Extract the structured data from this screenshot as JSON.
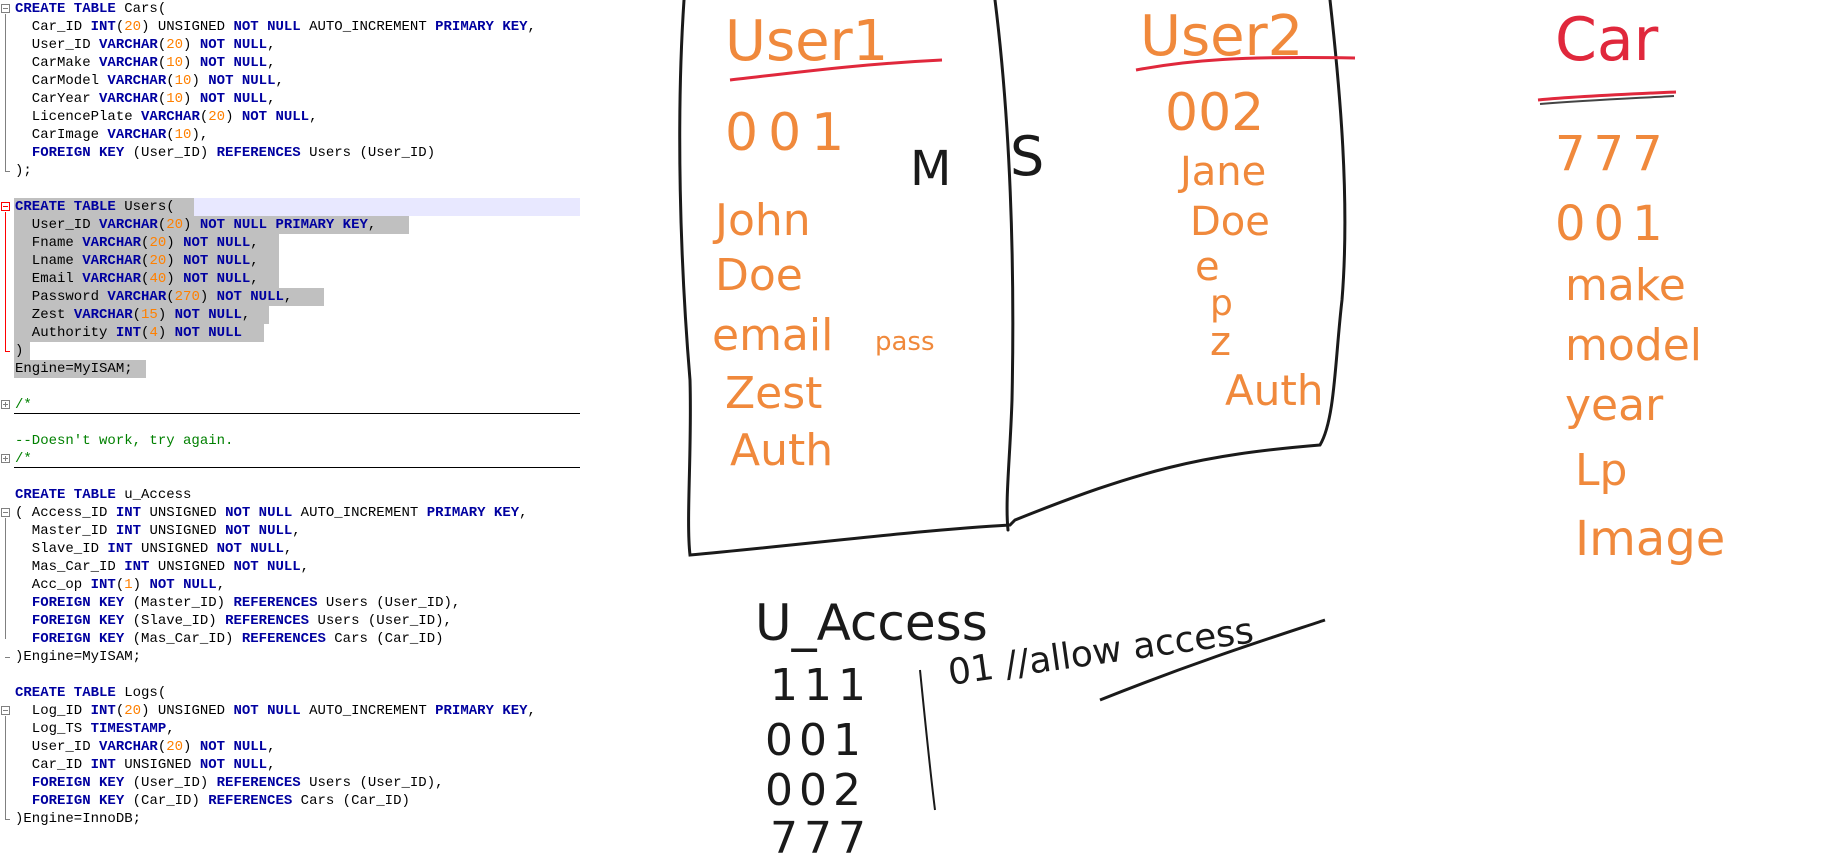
{
  "colors": {
    "keyword": "#0000a0",
    "number": "#ff8000",
    "comment": "#008000",
    "selection": "#c0c0c0",
    "current_line": "#e8e8ff",
    "sketch_orange": "#f0893c",
    "sketch_red": "#e0283c",
    "sketch_black": "#1a1a1a"
  },
  "code_lines": [
    [
      {
        "t": "CREATE TABLE",
        "k": "kw"
      },
      {
        "t": " Cars("
      }
    ],
    [
      {
        "t": "  Car_ID "
      },
      {
        "t": "INT",
        "k": "kw"
      },
      {
        "t": "("
      },
      {
        "t": "20",
        "k": "num"
      },
      {
        "t": ") UNSIGNED "
      },
      {
        "t": "NOT NULL",
        "k": "kw"
      },
      {
        "t": " AUTO_INCREMENT "
      },
      {
        "t": "PRIMARY KEY",
        "k": "kw"
      },
      {
        "t": ","
      }
    ],
    [
      {
        "t": "  User_ID "
      },
      {
        "t": "VARCHAR",
        "k": "kw"
      },
      {
        "t": "("
      },
      {
        "t": "20",
        "k": "num"
      },
      {
        "t": ") "
      },
      {
        "t": "NOT NULL",
        "k": "kw"
      },
      {
        "t": ","
      }
    ],
    [
      {
        "t": "  CarMake "
      },
      {
        "t": "VARCHAR",
        "k": "kw"
      },
      {
        "t": "("
      },
      {
        "t": "10",
        "k": "num"
      },
      {
        "t": ") "
      },
      {
        "t": "NOT NULL",
        "k": "kw"
      },
      {
        "t": ","
      }
    ],
    [
      {
        "t": "  CarModel "
      },
      {
        "t": "VARCHAR",
        "k": "kw"
      },
      {
        "t": "("
      },
      {
        "t": "10",
        "k": "num"
      },
      {
        "t": ") "
      },
      {
        "t": "NOT NULL",
        "k": "kw"
      },
      {
        "t": ","
      }
    ],
    [
      {
        "t": "  CarYear "
      },
      {
        "t": "VARCHAR",
        "k": "kw"
      },
      {
        "t": "("
      },
      {
        "t": "10",
        "k": "num"
      },
      {
        "t": ") "
      },
      {
        "t": "NOT NULL",
        "k": "kw"
      },
      {
        "t": ","
      }
    ],
    [
      {
        "t": "  LicencePlate "
      },
      {
        "t": "VARCHAR",
        "k": "kw"
      },
      {
        "t": "("
      },
      {
        "t": "20",
        "k": "num"
      },
      {
        "t": ") "
      },
      {
        "t": "NOT NULL",
        "k": "kw"
      },
      {
        "t": ","
      }
    ],
    [
      {
        "t": "  CarImage "
      },
      {
        "t": "VARCHAR",
        "k": "kw"
      },
      {
        "t": "("
      },
      {
        "t": "10",
        "k": "num"
      },
      {
        "t": "),"
      }
    ],
    [
      {
        "t": "  "
      },
      {
        "t": "FOREIGN KEY",
        "k": "kw"
      },
      {
        "t": " (User_ID) "
      },
      {
        "t": "REFERENCES",
        "k": "kw"
      },
      {
        "t": " Users (User_ID)"
      }
    ],
    [
      {
        "t": ");"
      }
    ],
    [],
    [
      {
        "t": "CREATE TABLE",
        "k": "kw"
      },
      {
        "t": " Users("
      }
    ],
    [
      {
        "t": "  User_ID "
      },
      {
        "t": "VARCHAR",
        "k": "kw"
      },
      {
        "t": "("
      },
      {
        "t": "20",
        "k": "num"
      },
      {
        "t": ") "
      },
      {
        "t": "NOT NULL PRIMARY KEY",
        "k": "kw"
      },
      {
        "t": ","
      }
    ],
    [
      {
        "t": "  Fname "
      },
      {
        "t": "VARCHAR",
        "k": "kw"
      },
      {
        "t": "("
      },
      {
        "t": "20",
        "k": "num"
      },
      {
        "t": ") "
      },
      {
        "t": "NOT NULL",
        "k": "kw"
      },
      {
        "t": ","
      }
    ],
    [
      {
        "t": "  Lname "
      },
      {
        "t": "VARCHAR",
        "k": "kw"
      },
      {
        "t": "("
      },
      {
        "t": "20",
        "k": "num"
      },
      {
        "t": ") "
      },
      {
        "t": "NOT NULL",
        "k": "kw"
      },
      {
        "t": ","
      }
    ],
    [
      {
        "t": "  Email "
      },
      {
        "t": "VARCHAR",
        "k": "kw"
      },
      {
        "t": "("
      },
      {
        "t": "40",
        "k": "num"
      },
      {
        "t": ") "
      },
      {
        "t": "NOT NULL",
        "k": "kw"
      },
      {
        "t": ","
      }
    ],
    [
      {
        "t": "  Password "
      },
      {
        "t": "VARCHAR",
        "k": "kw"
      },
      {
        "t": "("
      },
      {
        "t": "270",
        "k": "num"
      },
      {
        "t": ") "
      },
      {
        "t": "NOT NULL",
        "k": "kw"
      },
      {
        "t": ","
      }
    ],
    [
      {
        "t": "  Zest "
      },
      {
        "t": "VARCHAR",
        "k": "kw"
      },
      {
        "t": "("
      },
      {
        "t": "15",
        "k": "num"
      },
      {
        "t": ") "
      },
      {
        "t": "NOT NULL",
        "k": "kw"
      },
      {
        "t": ","
      }
    ],
    [
      {
        "t": "  Authority "
      },
      {
        "t": "INT",
        "k": "kw"
      },
      {
        "t": "("
      },
      {
        "t": "4",
        "k": "num"
      },
      {
        "t": ") "
      },
      {
        "t": "NOT NULL",
        "k": "kw"
      }
    ],
    [
      {
        "t": ")"
      }
    ],
    [
      {
        "t": "Engine=MyISAM;"
      }
    ],
    [],
    [
      {
        "t": "/*",
        "k": "cmt"
      }
    ],
    [],
    [
      {
        "t": "--Doesn't work, try again.",
        "k": "cmt"
      }
    ],
    [
      {
        "t": "/*",
        "k": "cmt"
      }
    ],
    [],
    [
      {
        "t": "CREATE TABLE",
        "k": "kw"
      },
      {
        "t": " u_Access"
      }
    ],
    [
      {
        "t": "( Access_ID "
      },
      {
        "t": "INT",
        "k": "kw"
      },
      {
        "t": " UNSIGNED "
      },
      {
        "t": "NOT NULL",
        "k": "kw"
      },
      {
        "t": " AUTO_INCREMENT "
      },
      {
        "t": "PRIMARY KEY",
        "k": "kw"
      },
      {
        "t": ","
      }
    ],
    [
      {
        "t": "  Master_ID "
      },
      {
        "t": "INT",
        "k": "kw"
      },
      {
        "t": " UNSIGNED "
      },
      {
        "t": "NOT NULL",
        "k": "kw"
      },
      {
        "t": ","
      }
    ],
    [
      {
        "t": "  Slave_ID "
      },
      {
        "t": "INT",
        "k": "kw"
      },
      {
        "t": " UNSIGNED "
      },
      {
        "t": "NOT NULL",
        "k": "kw"
      },
      {
        "t": ","
      }
    ],
    [
      {
        "t": "  Mas_Car_ID "
      },
      {
        "t": "INT",
        "k": "kw"
      },
      {
        "t": " UNSIGNED "
      },
      {
        "t": "NOT NULL",
        "k": "kw"
      },
      {
        "t": ","
      }
    ],
    [
      {
        "t": "  Acc_op "
      },
      {
        "t": "INT",
        "k": "kw"
      },
      {
        "t": "("
      },
      {
        "t": "1",
        "k": "num"
      },
      {
        "t": ") "
      },
      {
        "t": "NOT NULL",
        "k": "kw"
      },
      {
        "t": ","
      }
    ],
    [
      {
        "t": "  "
      },
      {
        "t": "FOREIGN KEY",
        "k": "kw"
      },
      {
        "t": " (Master_ID) "
      },
      {
        "t": "REFERENCES",
        "k": "kw"
      },
      {
        "t": " Users (User_ID),"
      }
    ],
    [
      {
        "t": "  "
      },
      {
        "t": "FOREIGN KEY",
        "k": "kw"
      },
      {
        "t": " (Slave_ID) "
      },
      {
        "t": "REFERENCES",
        "k": "kw"
      },
      {
        "t": " Users (User_ID),"
      }
    ],
    [
      {
        "t": "  "
      },
      {
        "t": "FOREIGN KEY",
        "k": "kw"
      },
      {
        "t": " (Mas_Car_ID) "
      },
      {
        "t": "REFERENCES",
        "k": "kw"
      },
      {
        "t": " Cars (Car_ID)"
      }
    ],
    [
      {
        "t": ")Engine=MyISAM;"
      }
    ],
    [],
    [
      {
        "t": "CREATE TABLE",
        "k": "kw"
      },
      {
        "t": " Logs("
      }
    ],
    [
      {
        "t": "  Log_ID "
      },
      {
        "t": "INT",
        "k": "kw"
      },
      {
        "t": "("
      },
      {
        "t": "20",
        "k": "num"
      },
      {
        "t": ") UNSIGNED "
      },
      {
        "t": "NOT NULL",
        "k": "kw"
      },
      {
        "t": " AUTO_INCREMENT "
      },
      {
        "t": "PRIMARY KEY",
        "k": "kw"
      },
      {
        "t": ","
      }
    ],
    [
      {
        "t": "  Log_TS "
      },
      {
        "t": "TIMESTAMP",
        "k": "kw"
      },
      {
        "t": ","
      }
    ],
    [
      {
        "t": "  User_ID "
      },
      {
        "t": "VARCHAR",
        "k": "kw"
      },
      {
        "t": "("
      },
      {
        "t": "20",
        "k": "num"
      },
      {
        "t": ") "
      },
      {
        "t": "NOT NULL",
        "k": "kw"
      },
      {
        "t": ","
      }
    ],
    [
      {
        "t": "  Car_ID "
      },
      {
        "t": "INT",
        "k": "kw"
      },
      {
        "t": " UNSIGNED "
      },
      {
        "t": "NOT NULL",
        "k": "kw"
      },
      {
        "t": ","
      }
    ],
    [
      {
        "t": "  "
      },
      {
        "t": "FOREIGN KEY",
        "k": "kw"
      },
      {
        "t": " (User_ID) "
      },
      {
        "t": "REFERENCES",
        "k": "kw"
      },
      {
        "t": " Users (User_ID),"
      }
    ],
    [
      {
        "t": "  "
      },
      {
        "t": "FOREIGN KEY",
        "k": "kw"
      },
      {
        "t": " (Car_ID) "
      },
      {
        "t": "REFERENCES",
        "k": "kw"
      },
      {
        "t": " Cars (Car_ID)"
      }
    ],
    [
      {
        "t": ")Engine=InnoDB;"
      }
    ]
  ],
  "sketch": {
    "user1": {
      "title": "User1",
      "id": "001",
      "items": [
        "John",
        "Doe",
        "email",
        "Zest",
        "Auth"
      ],
      "email_suffix": "pass",
      "role": "M"
    },
    "user2": {
      "title": "User2",
      "id": "002",
      "items": [
        "Jane",
        "Doe",
        "e",
        "p",
        "z",
        "Auth"
      ],
      "role": "S"
    },
    "car": {
      "title": "Car",
      "items": [
        "777",
        "001",
        "make",
        "model",
        "year",
        "Lp",
        "Image"
      ]
    },
    "u_access": {
      "title": "U_Access",
      "values": [
        "111",
        "001",
        "002",
        "777"
      ],
      "op": "01 //allow access"
    }
  }
}
